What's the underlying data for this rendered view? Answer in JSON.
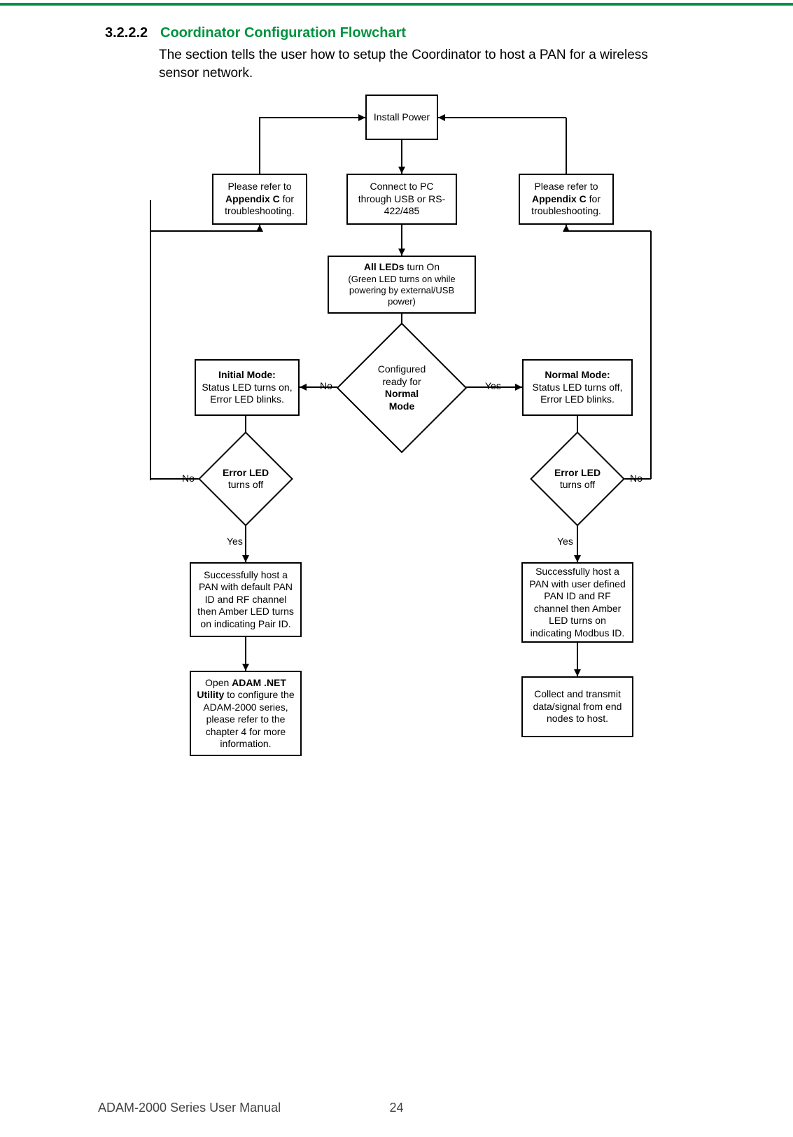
{
  "section_number": "3.2.2.2",
  "section_title": "Coordinator Configuration Flowchart",
  "intro": "The section tells the user how to setup the Coordinator to host a PAN for a wireless sensor network.",
  "footer": {
    "left": "ADAM-2000 Series User Manual",
    "page": "24"
  },
  "nodes": {
    "install": "Install Power",
    "connect": "Connect to PC through USB or RS-422/485",
    "leds_pre": "All LEDs",
    "leds_post": " turn On",
    "leds_sub": "(Green LED turns on while powering by external/USB power)",
    "cfg_line1": "Configured ready for",
    "cfg_line2": "Normal Mode",
    "initial_b": "Initial Mode:",
    "initial_rest": "Status LED turns on, Error LED blinks.",
    "normal_b": "Normal Mode:",
    "normal_rest": "Status LED turns off, Error LED blinks.",
    "refer_pre": "Please refer to ",
    "refer_b": "Appendix C",
    "refer_post": " for troubleshooting.",
    "err_b": "Error LED",
    "err_rest": " turns off",
    "pan_default": "Successfully host a PAN with default PAN ID and RF channel then Amber LED turns on indicating Pair ID.",
    "open_pre": "Open ",
    "open_b": "ADAM .NET Utility",
    "open_post": " to configure the ADAM-2000 series, please refer to the chapter 4 for more information.",
    "pan_user": "Successfully host a PAN with user defined PAN ID and RF channel then Amber LED turns on indicating Modbus ID.",
    "collect": "Collect and transmit data/signal from end nodes to host."
  },
  "labels": {
    "yes": "Yes",
    "no": "No"
  }
}
